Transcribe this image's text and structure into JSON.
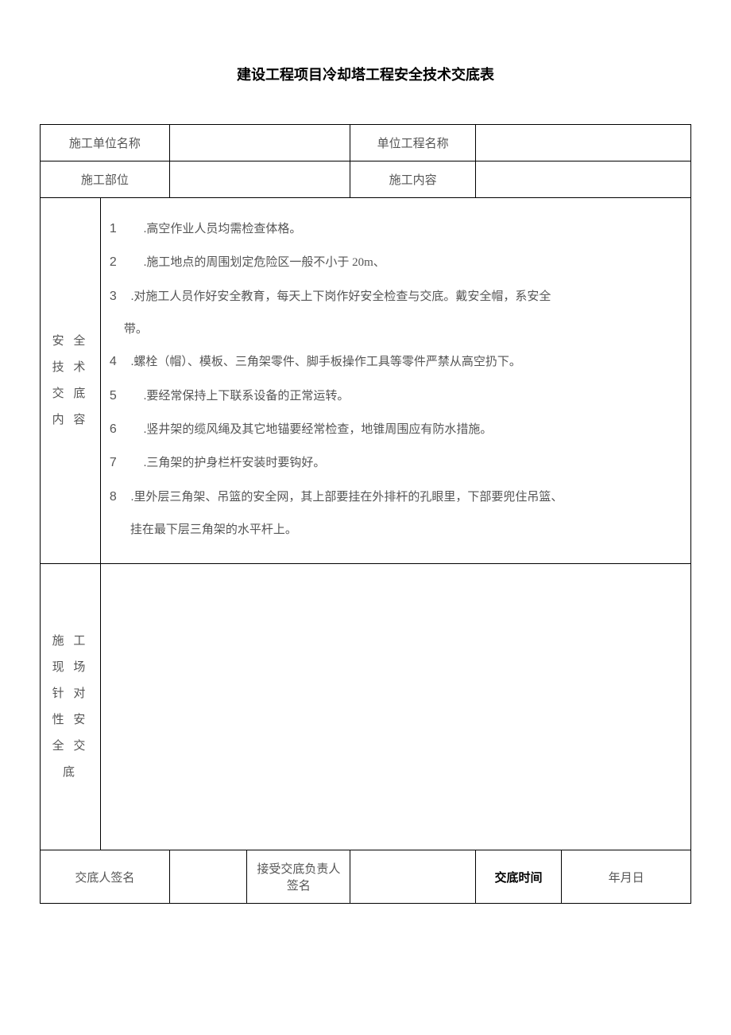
{
  "title": "建设工程项目冷却塔工程安全技术交底表",
  "row1": {
    "label1": "施工单位名称",
    "value1": "",
    "label2": "单位工程名称",
    "value2": ""
  },
  "row2": {
    "label1": "施工部位",
    "value1": "",
    "label2": "施工内容",
    "value2": ""
  },
  "section1": {
    "label": "安 全 技 术 交 底 内 容",
    "items": {
      "n1": "1",
      "t1": ".高空作业人员均需检查体格。",
      "n2": "2",
      "t2": ".施工地点的周围划定危险区一般不小于 20m、",
      "n3": "3",
      "t3": ".对施工人员作好安全教育，每天上下岗作好安全检查与交底。戴安全帽，系安全",
      "t3b": "带。",
      "n4": "4",
      "t4": ".螺栓（帽）、模板、三角架零件、脚手板操作工具等零件严禁从高空扔下。",
      "n5": "5",
      "t5": ".要经常保持上下联系设备的正常运转。",
      "n6": "6",
      "t6": ".竖井架的缆风绳及其它地锚要经常检查，地锥周围应有防水措施。",
      "n7": "7",
      "t7": ".三角架的护身栏杆安装时要钩好。",
      "n8": "8",
      "t8": ".里外层三角架、吊篮的安全网，其上部要挂在外排杆的孔眼里，下部要兜住吊篮、",
      "t8b": "挂在最下层三角架的水平杆上。"
    }
  },
  "section2": {
    "label": "施 工 现 场 针 对 性 安 全 交 底",
    "content": ""
  },
  "footer": {
    "label1": "交底人签名",
    "value1": "",
    "label2": "接受交底负责人签名",
    "value2": "",
    "label3": "交底时间",
    "value3": "年月日"
  }
}
